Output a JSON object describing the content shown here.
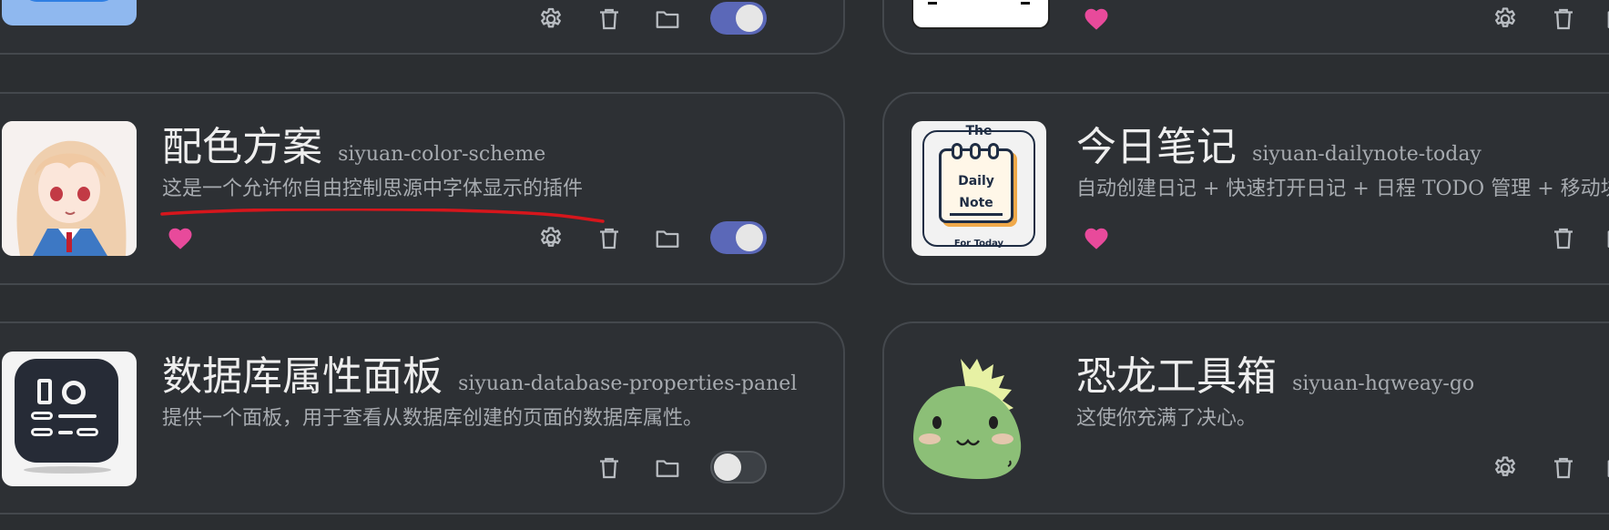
{
  "colors": {
    "accent": "#5b68b8",
    "heart": "#e84a9b",
    "annotation": "#d6161c"
  },
  "plugins": [
    {
      "id": "top-left",
      "title": "",
      "package": "",
      "description": "",
      "enabled": true
    },
    {
      "id": "top-right",
      "title": "",
      "package": "",
      "description": ""
    },
    {
      "id": "color-scheme",
      "title": "配色方案",
      "package": "siyuan-color-scheme",
      "description": "这是一个允许你自由控制思源中字体显示的插件",
      "enabled": true,
      "icon": "anime-avatar-image"
    },
    {
      "id": "dailynote-today",
      "title": "今日笔记",
      "package": "siyuan-dailynote-today",
      "description": "自动创建日记 + 快速打开日记 + 日程 TODO 管理 + 移动块",
      "icon_text": {
        "top": "The",
        "line1": "Daily",
        "line2": "Note",
        "bottom": "For Today"
      }
    },
    {
      "id": "database-properties-panel",
      "title": "数据库属性面板",
      "package": "siyuan-database-properties-panel",
      "description": "提供一个面板，用于查看从数据库创建的页面的数据库属性。",
      "enabled": false,
      "icon": "settings-panel-icon"
    },
    {
      "id": "hqweay-go",
      "title": "恐龙工具箱",
      "package": "siyuan-hqweay-go",
      "description": "这使你充满了决心。",
      "icon": "green-dinosaur-image"
    }
  ]
}
